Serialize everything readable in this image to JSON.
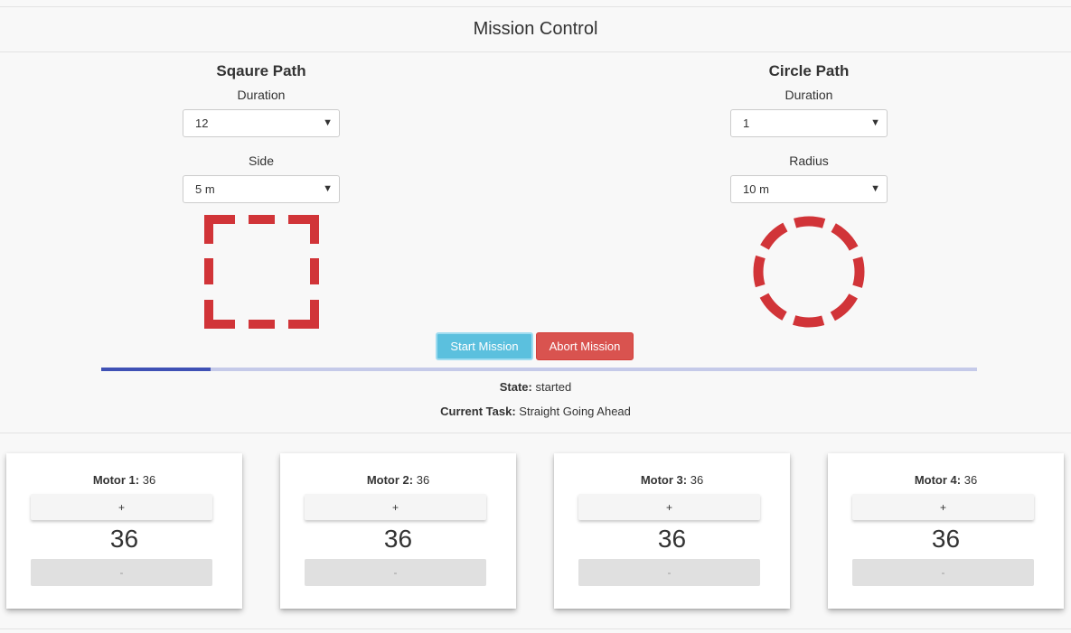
{
  "header": {
    "title": "Mission Control"
  },
  "square_path": {
    "title": "Sqaure Path",
    "duration_label": "Duration",
    "duration_value": "12",
    "side_label": "Side",
    "side_value": "5 m"
  },
  "circle_path": {
    "title": "Circle Path",
    "duration_label": "Duration",
    "duration_value": "1",
    "radius_label": "Radius",
    "radius_value": "10 m"
  },
  "actions": {
    "start_label": "Start Mission",
    "abort_label": "Abort Mission"
  },
  "progress": {
    "fraction": 0.125
  },
  "status": {
    "state_label": "State:",
    "state_value": "started",
    "task_label": "Current Task:",
    "task_value": "Straight Going Ahead"
  },
  "motors": [
    {
      "label": "Motor 1:",
      "value": "36",
      "display": "36",
      "plus": "+",
      "minus": "-"
    },
    {
      "label": "Motor 2:",
      "value": "36",
      "display": "36",
      "plus": "+",
      "minus": "-"
    },
    {
      "label": "Motor 3:",
      "value": "36",
      "display": "36",
      "plus": "+",
      "minus": "-"
    },
    {
      "label": "Motor 4:",
      "value": "36",
      "display": "36",
      "plus": "+",
      "minus": "-"
    }
  ],
  "colors": {
    "shape": "#d13438",
    "start": "#5bc0de",
    "abort": "#d9534f",
    "progress_fill": "#3f51b5",
    "progress_track": "#c5cae9"
  },
  "icons": {
    "select_arrow": "caret-down-icon",
    "square_shape": "dashed-square-icon",
    "circle_shape": "dashed-circle-icon"
  }
}
